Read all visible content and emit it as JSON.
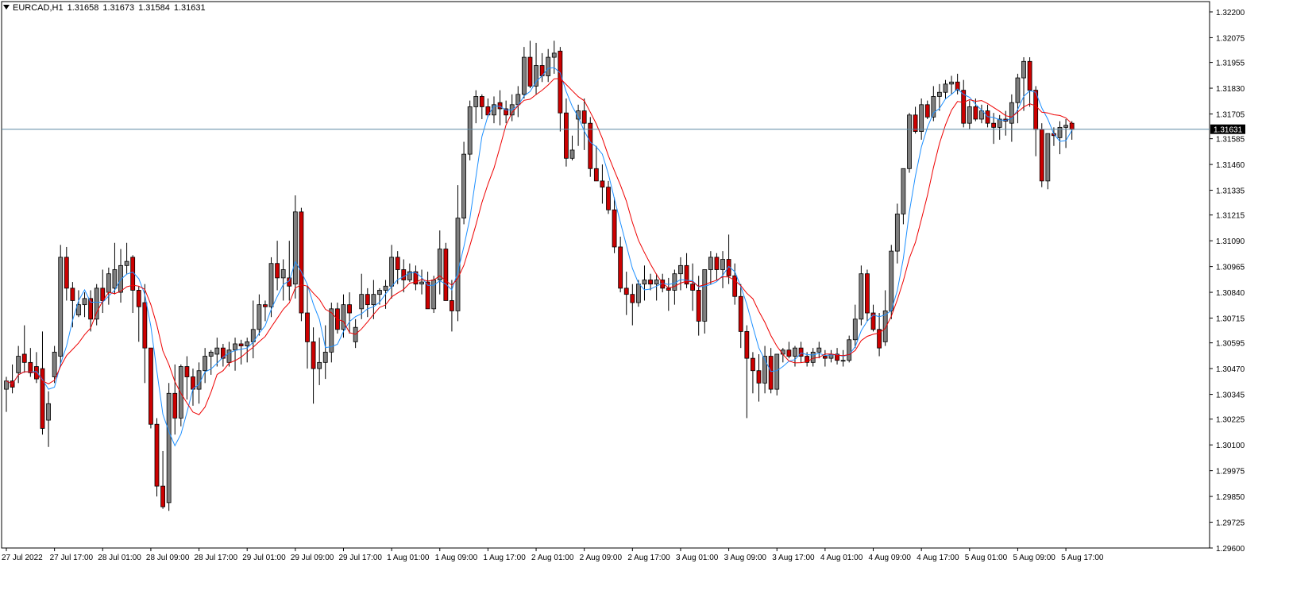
{
  "header": {
    "symbol": "EURCAD,H1",
    "open": "1.31658",
    "high": "1.31673",
    "low": "1.31584",
    "close": "1.31631"
  },
  "colors": {
    "bull": "#7f7f7f",
    "bear": "#cc0000",
    "ma_fast": "#1e90ff",
    "ma_slow": "#ee0000",
    "price_line": "#5b89a4",
    "frame": "#000000"
  },
  "chart_data": {
    "type": "candlestick",
    "y_ticks": [
      "1.32200",
      "1.32075",
      "1.31955",
      "1.31830",
      "1.31705",
      "1.31585",
      "1.31460",
      "1.31335",
      "1.31215",
      "1.31090",
      "1.30965",
      "1.30840",
      "1.30715",
      "1.30595",
      "1.30470",
      "1.30345",
      "1.30225",
      "1.30100",
      "1.29975",
      "1.29850",
      "1.29725",
      "1.29600"
    ],
    "ylim": [
      1.296,
      1.3225
    ],
    "x_ticks": [
      "27 Jul 2022",
      "27 Jul 17:00",
      "28 Jul 01:00",
      "28 Jul 09:00",
      "28 Jul 17:00",
      "29 Jul 01:00",
      "29 Jul 09:00",
      "29 Jul 17:00",
      "1 Aug 01:00",
      "1 Aug 09:00",
      "1 Aug 17:00",
      "2 Aug 01:00",
      "2 Aug 09:00",
      "2 Aug 17:00",
      "3 Aug 01:00",
      "3 Aug 09:00",
      "3 Aug 17:00",
      "4 Aug 01:00",
      "4 Aug 09:00",
      "4 Aug 17:00",
      "5 Aug 01:00",
      "5 Aug 09:00",
      "5 Aug 17:00"
    ],
    "bars_per_tick": 8,
    "current_price": "1.31631",
    "ohlc": [
      [
        1.3037,
        1.3043,
        1.3026,
        1.3041
      ],
      [
        1.3041,
        1.3049,
        1.3035,
        1.3038
      ],
      [
        1.3045,
        1.3058,
        1.304,
        1.3053
      ],
      [
        1.3054,
        1.3068,
        1.3045,
        1.305
      ],
      [
        1.305,
        1.3057,
        1.3043,
        1.3045
      ],
      [
        1.3048,
        1.3055,
        1.304,
        1.3042
      ],
      [
        1.3047,
        1.3065,
        1.3015,
        1.3018
      ],
      [
        1.3022,
        1.3036,
        1.3009,
        1.303
      ],
      [
        1.3043,
        1.3058,
        1.304,
        1.3055
      ],
      [
        1.3053,
        1.3107,
        1.3048,
        1.3101
      ],
      [
        1.3101,
        1.3106,
        1.308,
        1.3086
      ],
      [
        1.3086,
        1.3089,
        1.3067,
        1.308
      ],
      [
        1.3073,
        1.3085,
        1.3072,
        1.3078
      ],
      [
        1.3078,
        1.3084,
        1.3072,
        1.3081
      ],
      [
        1.3081,
        1.3085,
        1.3065,
        1.3071
      ],
      [
        1.3071,
        1.3088,
        1.3068,
        1.3086
      ],
      [
        1.3086,
        1.3095,
        1.3074,
        1.308
      ],
      [
        1.3084,
        1.3096,
        1.3078,
        1.3093
      ],
      [
        1.3086,
        1.3108,
        1.3083,
        1.3095
      ],
      [
        1.3084,
        1.3105,
        1.3079,
        1.3097
      ],
      [
        1.3097,
        1.3108,
        1.3093,
        1.3099
      ],
      [
        1.3101,
        1.3102,
        1.3074,
        1.3085
      ],
      [
        1.3085,
        1.3087,
        1.306,
        1.3077
      ],
      [
        1.3079,
        1.3088,
        1.304,
        1.3057
      ],
      [
        1.3057,
        1.3057,
        1.3018,
        1.302
      ],
      [
        1.302,
        1.3023,
        1.2985,
        1.299
      ],
      [
        1.299,
        1.3007,
        1.2979,
        1.298
      ],
      [
        1.2982,
        1.304,
        1.2978,
        1.3035
      ],
      [
        1.3035,
        1.3049,
        1.3015,
        1.3023
      ],
      [
        1.3023,
        1.3049,
        1.3019,
        1.3048
      ],
      [
        1.3048,
        1.3053,
        1.3032,
        1.3043
      ],
      [
        1.3043,
        1.3047,
        1.3029,
        1.3037
      ],
      [
        1.3037,
        1.305,
        1.303,
        1.3046
      ],
      [
        1.3046,
        1.3057,
        1.304,
        1.3053
      ],
      [
        1.3053,
        1.3056,
        1.3044,
        1.3055
      ],
      [
        1.3054,
        1.3062,
        1.3048,
        1.3057
      ],
      [
        1.3057,
        1.3059,
        1.3048,
        1.3052
      ],
      [
        1.305,
        1.306,
        1.3048,
        1.3056
      ],
      [
        1.3056,
        1.3062,
        1.3046,
        1.3059
      ],
      [
        1.3059,
        1.3061,
        1.3049,
        1.3058
      ],
      [
        1.3058,
        1.3062,
        1.305,
        1.306
      ],
      [
        1.306,
        1.308,
        1.3052,
        1.3066
      ],
      [
        1.3066,
        1.3083,
        1.3063,
        1.3078
      ],
      [
        1.3078,
        1.308,
        1.307,
        1.3077
      ],
      [
        1.3077,
        1.3101,
        1.3072,
        1.3098
      ],
      [
        1.3098,
        1.3109,
        1.3085,
        1.3091
      ],
      [
        1.3091,
        1.31,
        1.308,
        1.3095
      ],
      [
        1.3091,
        1.3109,
        1.308,
        1.3087
      ],
      [
        1.3088,
        1.3131,
        1.3081,
        1.3123
      ],
      [
        1.3123,
        1.3125,
        1.307,
        1.3074
      ],
      [
        1.3074,
        1.3087,
        1.3047,
        1.306
      ],
      [
        1.306,
        1.3067,
        1.303,
        1.3047
      ],
      [
        1.3047,
        1.3062,
        1.3039,
        1.305
      ],
      [
        1.305,
        1.3068,
        1.3042,
        1.3055
      ],
      [
        1.3055,
        1.3079,
        1.305,
        1.3076
      ],
      [
        1.3076,
        1.3079,
        1.3064,
        1.3066
      ],
      [
        1.3066,
        1.3083,
        1.3062,
        1.3078
      ],
      [
        1.3078,
        1.3084,
        1.3064,
        1.3074
      ],
      [
        1.306,
        1.3071,
        1.3057,
        1.3067
      ],
      [
        1.3076,
        1.3093,
        1.3071,
        1.3083
      ],
      [
        1.3083,
        1.3086,
        1.3072,
        1.3078
      ],
      [
        1.3078,
        1.309,
        1.3071,
        1.3083
      ],
      [
        1.3083,
        1.3086,
        1.3078,
        1.3085
      ],
      [
        1.3085,
        1.309,
        1.3076,
        1.3087
      ],
      [
        1.3087,
        1.3107,
        1.3081,
        1.3101
      ],
      [
        1.3101,
        1.3104,
        1.3088,
        1.3095
      ],
      [
        1.3095,
        1.31,
        1.3084,
        1.309
      ],
      [
        1.309,
        1.3098,
        1.3089,
        1.3094
      ],
      [
        1.3094,
        1.3097,
        1.3085,
        1.3088
      ],
      [
        1.3088,
        1.3095,
        1.3083,
        1.3089
      ],
      [
        1.3089,
        1.3094,
        1.3079,
        1.3076
      ],
      [
        1.3076,
        1.3092,
        1.3074,
        1.309
      ],
      [
        1.309,
        1.3114,
        1.3083,
        1.3105
      ],
      [
        1.3105,
        1.3108,
        1.308,
        1.308
      ],
      [
        1.308,
        1.309,
        1.3065,
        1.3075
      ],
      [
        1.3075,
        1.3136,
        1.307,
        1.312
      ],
      [
        1.312,
        1.3157,
        1.3117,
        1.3151
      ],
      [
        1.3151,
        1.3177,
        1.3148,
        1.3174
      ],
      [
        1.3174,
        1.3182,
        1.3166,
        1.3179
      ],
      [
        1.3179,
        1.318,
        1.3168,
        1.3174
      ],
      [
        1.3174,
        1.3178,
        1.3169,
        1.317
      ],
      [
        1.317,
        1.3179,
        1.3166,
        1.3175
      ],
      [
        1.3176,
        1.3182,
        1.3165,
        1.3173
      ],
      [
        1.3173,
        1.3177,
        1.3166,
        1.317
      ],
      [
        1.317,
        1.318,
        1.3167,
        1.3175
      ],
      [
        1.3175,
        1.3184,
        1.3169,
        1.318
      ],
      [
        1.318,
        1.3203,
        1.3178,
        1.3198
      ],
      [
        1.3198,
        1.3206,
        1.3183,
        1.3184
      ],
      [
        1.3184,
        1.3205,
        1.318,
        1.3194
      ],
      [
        1.3194,
        1.32,
        1.3186,
        1.3189
      ],
      [
        1.3189,
        1.3202,
        1.3186,
        1.3198
      ],
      [
        1.3198,
        1.3206,
        1.319,
        1.32
      ],
      [
        1.3201,
        1.3203,
        1.3162,
        1.3171
      ],
      [
        1.3171,
        1.3178,
        1.3145,
        1.3149
      ],
      [
        1.3149,
        1.316,
        1.3148,
        1.3153
      ],
      [
        1.3168,
        1.3175,
        1.3155,
        1.3172
      ],
      [
        1.3172,
        1.3178,
        1.3153,
        1.3166
      ],
      [
        1.3166,
        1.3169,
        1.314,
        1.3144
      ],
      [
        1.3144,
        1.3155,
        1.3139,
        1.3138
      ],
      [
        1.3138,
        1.3146,
        1.3127,
        1.3135
      ],
      [
        1.3135,
        1.3138,
        1.3122,
        1.3124
      ],
      [
        1.3124,
        1.313,
        1.3103,
        1.3106
      ],
      [
        1.3106,
        1.3111,
        1.3084,
        1.3086
      ],
      [
        1.3086,
        1.3094,
        1.3073,
        1.3083
      ],
      [
        1.3083,
        1.3088,
        1.3068,
        1.3079
      ],
      [
        1.3079,
        1.309,
        1.3077,
        1.3088
      ],
      [
        1.3088,
        1.3097,
        1.308,
        1.309
      ],
      [
        1.309,
        1.3093,
        1.3085,
        1.3088
      ],
      [
        1.3088,
        1.3093,
        1.308,
        1.309
      ],
      [
        1.309,
        1.3093,
        1.3084,
        1.3086
      ],
      [
        1.3086,
        1.3091,
        1.3075,
        1.3085
      ],
      [
        1.3085,
        1.3095,
        1.3078,
        1.3093
      ],
      [
        1.3093,
        1.3101,
        1.3085,
        1.3097
      ],
      [
        1.3097,
        1.3103,
        1.3086,
        1.3088
      ],
      [
        1.3088,
        1.3098,
        1.3075,
        1.3085
      ],
      [
        1.3085,
        1.3092,
        1.3063,
        1.307
      ],
      [
        1.307,
        1.3094,
        1.3064,
        1.3095
      ],
      [
        1.3095,
        1.3104,
        1.3088,
        1.3101
      ],
      [
        1.3101,
        1.3103,
        1.309,
        1.3095
      ],
      [
        1.3095,
        1.3104,
        1.3086,
        1.31
      ],
      [
        1.31,
        1.3112,
        1.3088,
        1.3092
      ],
      [
        1.3092,
        1.3098,
        1.3078,
        1.3082
      ],
      [
        1.3082,
        1.3088,
        1.3057,
        1.3065
      ],
      [
        1.3065,
        1.3068,
        1.3023,
        1.3052
      ],
      [
        1.3052,
        1.3055,
        1.3035,
        1.3046
      ],
      [
        1.3046,
        1.3054,
        1.3031,
        1.304
      ],
      [
        1.304,
        1.3058,
        1.3035,
        1.3053
      ],
      [
        1.3053,
        1.3057,
        1.3035,
        1.3037
      ],
      [
        1.3037,
        1.3046,
        1.3034,
        1.3054
      ],
      [
        1.3054,
        1.3057,
        1.305,
        1.3056
      ],
      [
        1.3056,
        1.306,
        1.3052,
        1.3053
      ],
      [
        1.3053,
        1.3058,
        1.3048,
        1.3057
      ],
      [
        1.3057,
        1.306,
        1.305,
        1.3053
      ],
      [
        1.3053,
        1.3055,
        1.3048,
        1.305
      ],
      [
        1.305,
        1.3057,
        1.3048,
        1.3055
      ],
      [
        1.3055,
        1.306,
        1.3052,
        1.3057
      ],
      [
        1.3053,
        1.3056,
        1.3048,
        1.3052
      ],
      [
        1.3052,
        1.3056,
        1.305,
        1.3054
      ],
      [
        1.3054,
        1.3057,
        1.3049,
        1.3051
      ],
      [
        1.3051,
        1.3056,
        1.3048,
        1.3051
      ],
      [
        1.3051,
        1.3063,
        1.305,
        1.3061
      ],
      [
        1.3061,
        1.3078,
        1.3057,
        1.3071
      ],
      [
        1.3071,
        1.3097,
        1.3068,
        1.3093
      ],
      [
        1.3093,
        1.3095,
        1.307,
        1.3074
      ],
      [
        1.3074,
        1.3078,
        1.3065,
        1.3066
      ],
      [
        1.3066,
        1.3074,
        1.3053,
        1.3057
      ],
      [
        1.306,
        1.3085,
        1.3058,
        1.3075
      ],
      [
        1.3075,
        1.3107,
        1.3071,
        1.3104
      ],
      [
        1.3104,
        1.3127,
        1.3098,
        1.3122
      ],
      [
        1.3122,
        1.3143,
        1.3117,
        1.3144
      ],
      [
        1.3144,
        1.3171,
        1.3142,
        1.317
      ],
      [
        1.317,
        1.3174,
        1.3161,
        1.3162
      ],
      [
        1.3162,
        1.3178,
        1.3158,
        1.3175
      ],
      [
        1.3175,
        1.3177,
        1.3168,
        1.3169
      ],
      [
        1.3169,
        1.3184,
        1.3167,
        1.3179
      ],
      [
        1.3179,
        1.3185,
        1.3172,
        1.3181
      ],
      [
        1.3181,
        1.3187,
        1.3178,
        1.3185
      ],
      [
        1.3185,
        1.3189,
        1.318,
        1.3186
      ],
      [
        1.3186,
        1.319,
        1.318,
        1.3182
      ],
      [
        1.3182,
        1.3187,
        1.3164,
        1.3166
      ],
      [
        1.3166,
        1.3177,
        1.3163,
        1.3174
      ],
      [
        1.3174,
        1.3178,
        1.3167,
        1.3168
      ],
      [
        1.3168,
        1.3175,
        1.3166,
        1.3172
      ],
      [
        1.3172,
        1.3175,
        1.3164,
        1.3166
      ],
      [
        1.3166,
        1.3171,
        1.3156,
        1.3164
      ],
      [
        1.3164,
        1.317,
        1.3158,
        1.3168
      ],
      [
        1.3168,
        1.3172,
        1.316,
        1.3167
      ],
      [
        1.3166,
        1.318,
        1.3157,
        1.3176
      ],
      [
        1.3176,
        1.319,
        1.3166,
        1.3188
      ],
      [
        1.3188,
        1.3198,
        1.3172,
        1.3196
      ],
      [
        1.3196,
        1.3198,
        1.3174,
        1.3182
      ],
      [
        1.3182,
        1.3184,
        1.315,
        1.3163
      ],
      [
        1.3163,
        1.3166,
        1.3135,
        1.3138
      ],
      [
        1.3138,
        1.316,
        1.3134,
        1.3161
      ],
      [
        1.3161,
        1.3164,
        1.3155,
        1.316
      ],
      [
        1.3159,
        1.3167,
        1.3151,
        1.3164
      ],
      [
        1.3164,
        1.3168,
        1.3154,
        1.3165
      ],
      [
        1.3166,
        1.3167,
        1.3158,
        1.3163
      ]
    ],
    "indicators": [
      {
        "type": "moving-average",
        "color": "#1e90ff"
      },
      {
        "type": "moving-average",
        "color": "#ee0000"
      }
    ]
  }
}
